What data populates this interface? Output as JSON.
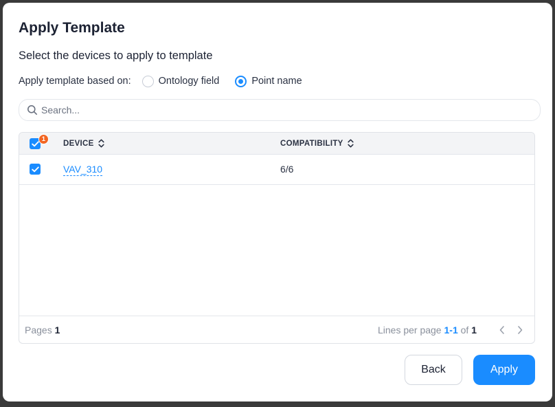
{
  "dialog": {
    "title": "Apply Template",
    "subtitle": "Select the devices to apply to template"
  },
  "based_on": {
    "label": "Apply template based on:",
    "options": [
      {
        "label": "Ontology field",
        "selected": false
      },
      {
        "label": "Point name",
        "selected": true
      }
    ]
  },
  "search": {
    "placeholder": "Search...",
    "value": ""
  },
  "table": {
    "select_all_badge": "1",
    "columns": [
      "DEVICE",
      "COMPATIBILITY"
    ],
    "rows": [
      {
        "device": "VAV_310",
        "compatibility": "6/6",
        "checked": true
      }
    ],
    "footer": {
      "pages_label": "Pages",
      "pages_value": "1",
      "lines_label": "Lines per page",
      "range": "1-1",
      "of_label": "of",
      "total": "1"
    }
  },
  "buttons": {
    "back": "Back",
    "apply": "Apply"
  },
  "colors": {
    "accent": "#1a8cff",
    "badge": "#f26522"
  }
}
